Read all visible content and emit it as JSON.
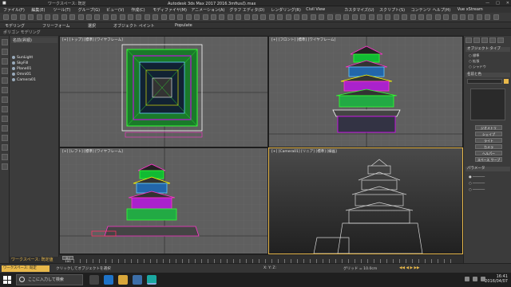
{
  "title_bar": {
    "workspace": "ワークスペース: 既定",
    "title": "Autodesk 3ds Max 2017    2016.3mfiusの.max"
  },
  "menu": [
    "ファイル(F)",
    "編集(E)",
    "ツール(T)",
    "グループ(G)",
    "ビュー(V)",
    "作成(C)",
    "モディファイヤ(M)",
    "アニメーション(A)",
    "グラフ エディタ(D)",
    "レンダリング(R)",
    "Civil View",
    "カスタマイズ(U)",
    "スクリプト(S)",
    "コンテンツ",
    "ヘルプ(H)",
    "Vue xStream"
  ],
  "ribbon": {
    "tabs": [
      "モデリング",
      "フリーフォーム",
      "選択",
      "オブジェクト ペイント",
      "Populate"
    ],
    "sub": [
      "ポリゴン モデリング"
    ]
  },
  "explorer": {
    "header": "名前(昇順)",
    "items": [
      "SunLight",
      "SkyFill",
      "Plane01",
      "Omni01",
      "Camera01"
    ],
    "footer": "ワークスペース: 既定値"
  },
  "viewports": {
    "top": "[+] [トップ] [標準] [ワイヤフレーム]",
    "front": "[+] [フロント] [標準] [ワイヤフレーム]",
    "left": "[+] [レフト] [標準] [ワイヤフレーム]",
    "camera": "[+] [Camera01] [リニア] [標準] [線画]"
  },
  "command_panel": {
    "sec1": "オブジェクト タイプ",
    "radio": [
      "標準",
      "拡張",
      "シャドウ"
    ],
    "sec2": "名前と色",
    "name_field": "",
    "buttons": [
      "ジオメトリ",
      "シェイプ",
      "ライト",
      "カメラ",
      "ヘルパー",
      "スペース ワープ"
    ],
    "sec3": "パラメータ"
  },
  "timeline": {
    "frame": "0 / 100"
  },
  "status": {
    "script": "ワークスペース: 既定",
    "hint": "クリックしてオブジェクトを選択",
    "coords": "X:  Y:  Z:",
    "grid": "グリッド = 10.0cm"
  },
  "taskbar": {
    "search": "ここに入力して検索",
    "time": "16:41",
    "date": "2016/04/07"
  },
  "colors": {
    "accent": "#e8b84a",
    "viewport": "#5f5f5f",
    "camera_vp": "#2c2c2c"
  }
}
